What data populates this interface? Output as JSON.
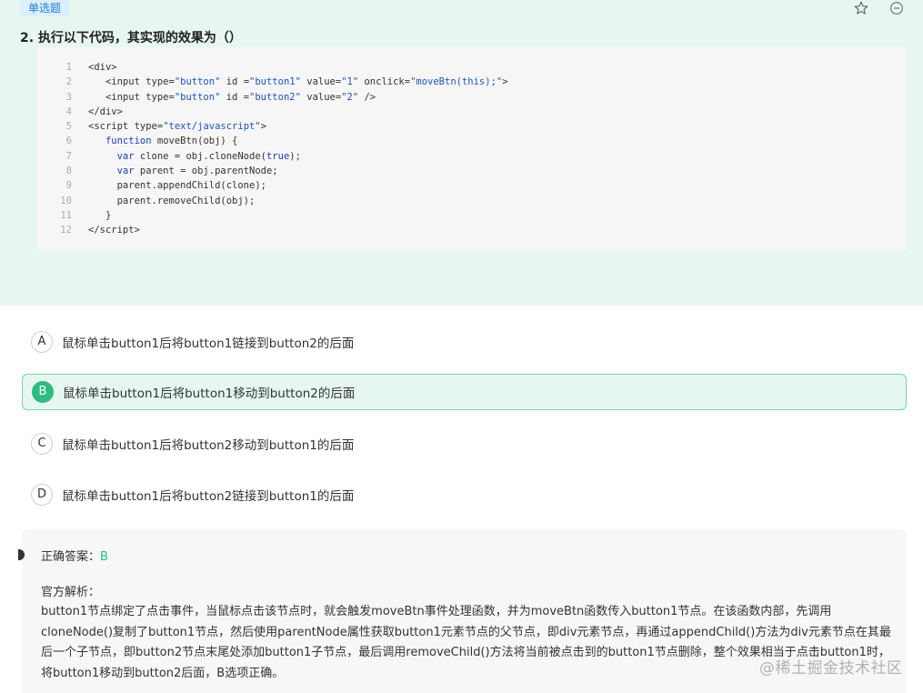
{
  "question": {
    "type_tag": "单选题",
    "title": "2. 执行以下代码，其实现的效果为（）",
    "code_lines": [
      {
        "num": "1",
        "html": "&lt;div&gt;"
      },
      {
        "num": "2",
        "html": "   &lt;input type=<span class=\"str\">\"button\"</span> id =<span class=\"str\">\"button1\"</span> value=<span class=\"str\">\"1\"</span> onclick=<span class=\"str\">\"moveBtn(this);\"</span>&gt;"
      },
      {
        "num": "3",
        "html": "   &lt;input type=<span class=\"str\">\"button\"</span> id =<span class=\"str\">\"button2\"</span> value=<span class=\"str\">\"2\"</span> /&gt;"
      },
      {
        "num": "4",
        "html": "&lt;/div&gt;"
      },
      {
        "num": "5",
        "html": "&lt;script type=<span class=\"str\">\"text/javascript\"</span>&gt;"
      },
      {
        "num": "6",
        "html": "   <span class=\"kw\">function</span> moveBtn(obj) {"
      },
      {
        "num": "7",
        "html": "     <span class=\"kw\">var</span> clone = obj.cloneNode(<span class=\"lit\">true</span>);"
      },
      {
        "num": "8",
        "html": "     <span class=\"kw\">var</span> parent = obj.parentNode;"
      },
      {
        "num": "9",
        "html": "     parent.appendChild(clone);"
      },
      {
        "num": "10",
        "html": "     parent.removeChild(obj);"
      },
      {
        "num": "11",
        "html": "   }"
      },
      {
        "num": "12",
        "html": "&lt;/script&gt;"
      }
    ]
  },
  "options": [
    {
      "letter": "A",
      "text": "鼠标单击button1后将button1链接到button2的后面",
      "selected": false
    },
    {
      "letter": "B",
      "text": "鼠标单击button1后将button1移动到button2的后面",
      "selected": true
    },
    {
      "letter": "C",
      "text": "鼠标单击button1后将button2移动到button1的后面",
      "selected": false
    },
    {
      "letter": "D",
      "text": "鼠标单击button1后将button2链接到button1的后面",
      "selected": false
    }
  ],
  "analysis": {
    "answer_label": "正确答案：",
    "answer_value": "B",
    "title": "官方解析：",
    "text": "button1节点绑定了点击事件，当鼠标点击该节点时，就会触发moveBtn事件处理函数，并为moveBtn函数传入button1节点。在该函数内部，先调用cloneNode()复制了button1节点，然后使用parentNode属性获取button1元素节点的父节点，即div元素节点，再通过appendChild()方法为div元素节点在其最后一个子节点，即button2节点末尾处添加button1子节点，最后调用removeChild()方法将当前被点击到的button1节点删除，整个效果相当于点击button1时，将button1移动到button2后面，B选项正确。"
  },
  "watermark": "@稀土掘金技术社区",
  "colors": {
    "panel_bg": "#e8f6f1",
    "accent_green": "#2dbd82",
    "tag_blue": "#1f7ed1"
  }
}
